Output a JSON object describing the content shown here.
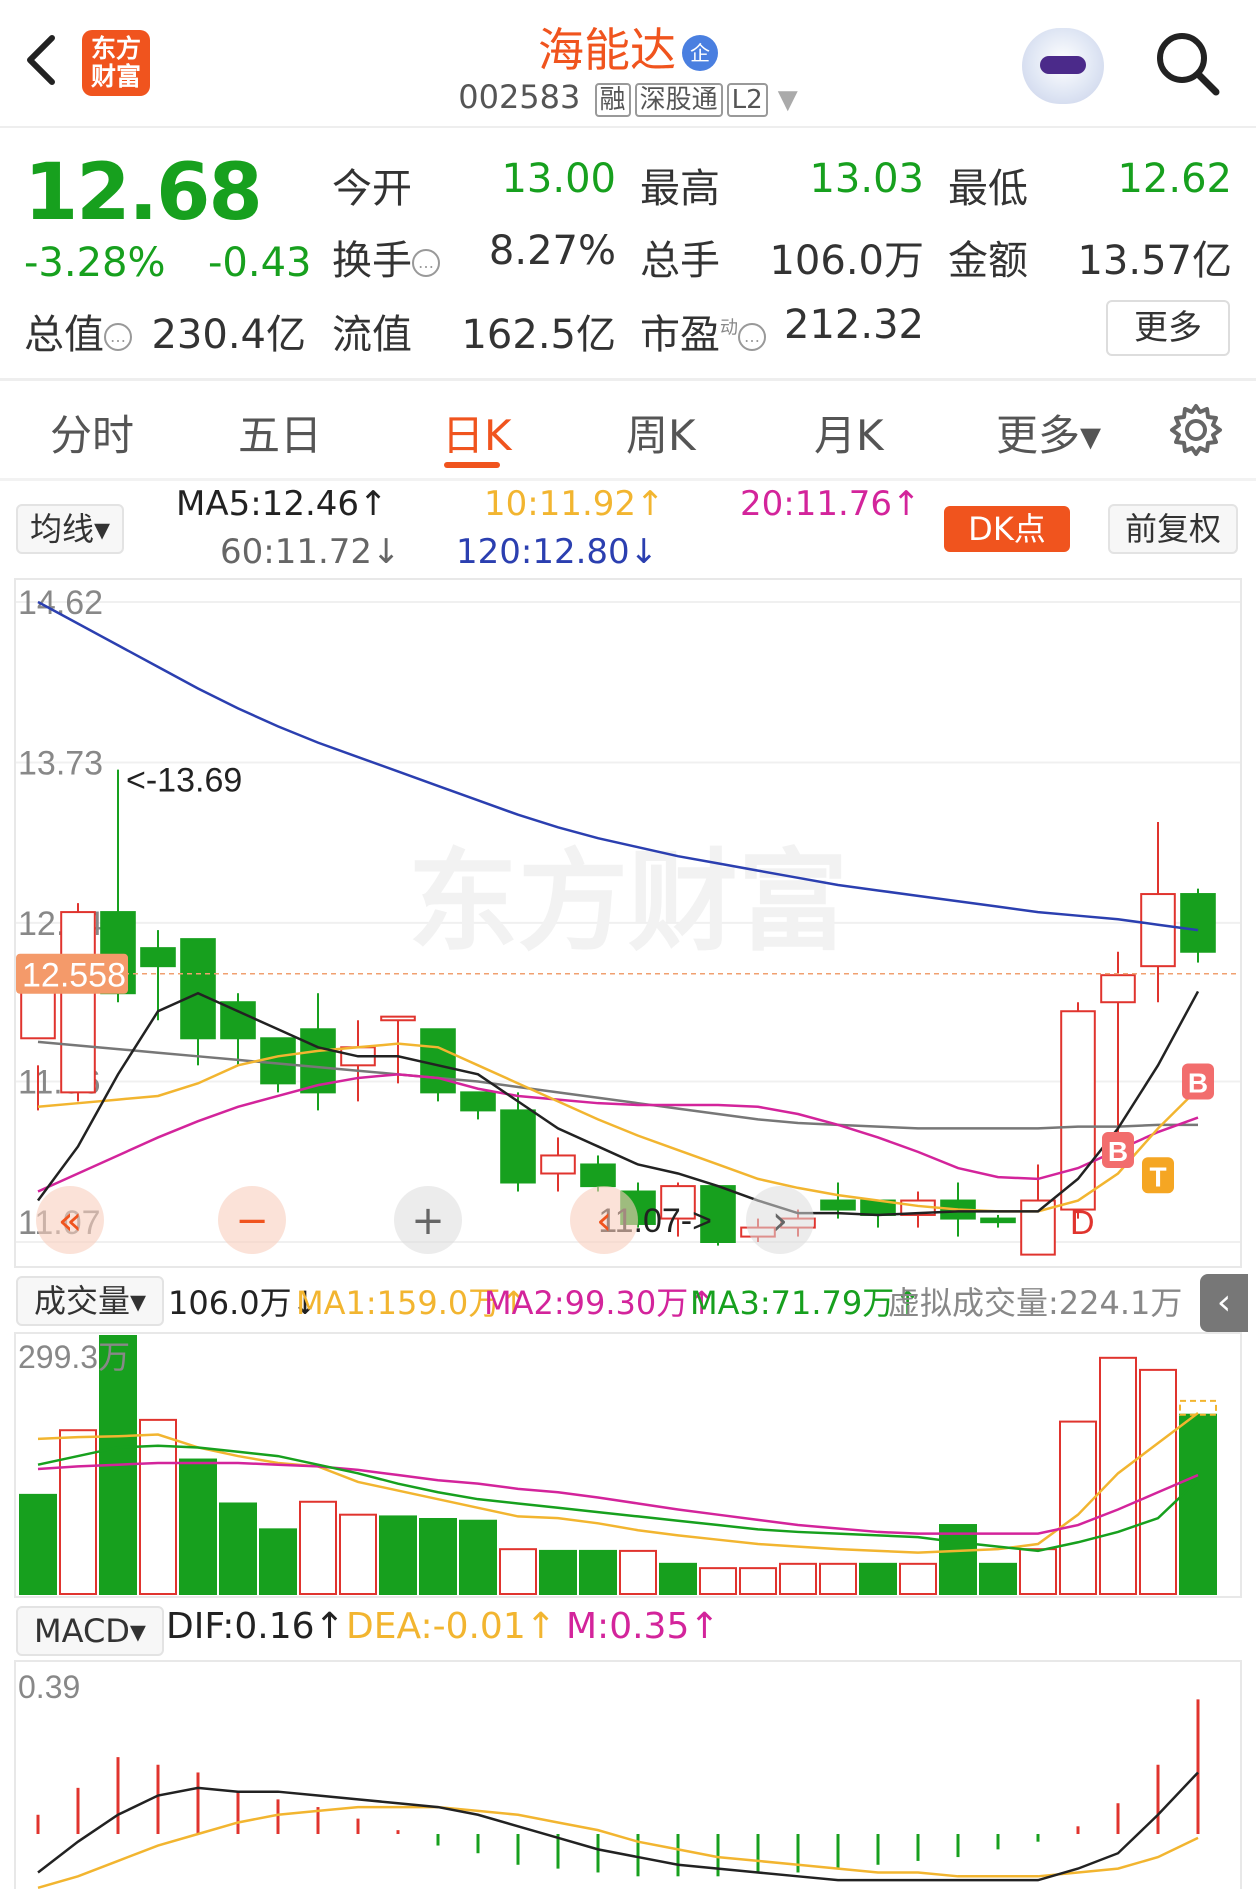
{
  "header": {
    "back_icon": "chevron-left-icon",
    "logo_text": "东方财富",
    "stock_name": "海能达",
    "badge": "企",
    "stock_code": "002583",
    "tags": [
      "融",
      "深股通",
      "L2"
    ],
    "search_icon": "search-icon"
  },
  "quote": {
    "price": "12.68",
    "change_pct": "-3.28%",
    "change_amt": "-0.43",
    "open_label": "今开",
    "open": "13.00",
    "high_label": "最高",
    "high": "13.03",
    "low_label": "最低",
    "low": "12.62",
    "turnover_label": "换手",
    "turnover": "8.27%",
    "volume_label": "总手",
    "volume": "106.0万",
    "amount_label": "金额",
    "amount": "13.57亿",
    "mktcap_label": "总值",
    "mktcap": "230.4亿",
    "float_label": "流值",
    "float": "162.5亿",
    "pe_label": "市盈",
    "pe_sup": "动",
    "pe": "212.32",
    "more": "更多"
  },
  "tabs": [
    {
      "label": "分时"
    },
    {
      "label": "五日"
    },
    {
      "label": "日K"
    },
    {
      "label": "周K"
    },
    {
      "label": "月K"
    },
    {
      "label": "更多▾"
    }
  ],
  "ma_row": {
    "selector": "均线▾",
    "ma5": "MA5:12.46↑",
    "ma10": "10:11.92↑",
    "ma20": "20:11.76↑",
    "ma60": "60:11.72↓",
    "ma120": "120:12.80↓",
    "dk": "DK点",
    "adjust": "前复权"
  },
  "kline": {
    "y_labels": [
      "14.62",
      "13.73",
      "12.84",
      "11.96",
      "11.07"
    ],
    "current_price_label": "12.558",
    "high_marker": "<-13.69",
    "low_marker": "11.07->",
    "watermark": "东方财富",
    "signals": [
      "B",
      "B",
      "T",
      "D"
    ]
  },
  "volume": {
    "selector": "成交量▾",
    "value": "106.0万↓",
    "ma1": "MA1:159.0万↑",
    "ma2": "MA2:99.30万↑",
    "ma3": "MA3:71.79万↑",
    "virtual": "虚拟成交量:224.1万",
    "max_label": "299.3万"
  },
  "macd": {
    "selector": "MACD▾",
    "dif": "DIF:0.16↑",
    "dea": "DEA:-0.01↑",
    "m": "M:0.35↑",
    "max_label": "0.39"
  },
  "colors": {
    "up": "#e0342e",
    "down": "#17a01e",
    "accent": "#f0541e",
    "ma5": "#222222",
    "ma10": "#f2b530",
    "ma20": "#d3249b",
    "ma60": "#777777",
    "ma120": "#2b3fb0"
  },
  "chart_data": [
    {
      "type": "candlestick",
      "title": "",
      "y_ticks": [
        14.62,
        13.73,
        12.84,
        11.96,
        11.07
      ],
      "high_marker": 13.69,
      "low_marker": 11.07,
      "ohlc": [
        [
          12.2,
          12.05,
          11.8,
          12.55
        ],
        [
          11.9,
          12.95,
          11.85,
          12.9
        ],
        [
          12.9,
          13.69,
          12.4,
          12.45
        ],
        [
          12.7,
          12.8,
          12.3,
          12.6
        ],
        [
          12.75,
          12.75,
          12.05,
          12.2
        ],
        [
          12.4,
          12.45,
          12.05,
          12.2
        ],
        [
          12.2,
          12.2,
          11.9,
          11.95
        ],
        [
          12.25,
          12.45,
          11.8,
          11.9
        ],
        [
          12.05,
          12.3,
          11.85,
          12.15
        ],
        [
          12.3,
          12.32,
          11.95,
          12.32
        ],
        [
          12.25,
          12.25,
          11.85,
          11.9
        ],
        [
          11.9,
          11.9,
          11.75,
          11.8
        ],
        [
          11.8,
          11.9,
          11.35,
          11.4
        ],
        [
          11.45,
          11.65,
          11.35,
          11.55
        ],
        [
          11.5,
          11.55,
          11.35,
          11.38
        ],
        [
          11.35,
          11.4,
          11.15,
          11.17
        ],
        [
          11.2,
          11.4,
          11.1,
          11.38
        ],
        [
          11.38,
          11.38,
          11.05,
          11.07
        ],
        [
          11.1,
          11.2,
          11.07,
          11.15
        ],
        [
          11.15,
          11.25,
          11.1,
          11.2
        ],
        [
          11.3,
          11.4,
          11.2,
          11.25
        ],
        [
          11.3,
          11.3,
          11.15,
          11.22
        ],
        [
          11.22,
          11.35,
          11.15,
          11.3
        ],
        [
          11.3,
          11.4,
          11.1,
          11.2
        ],
        [
          11.2,
          11.22,
          11.15,
          11.18
        ],
        [
          11.0,
          11.5,
          11.0,
          11.3
        ],
        [
          11.25,
          12.4,
          11.2,
          12.35
        ],
        [
          12.4,
          12.68,
          11.6,
          12.55
        ],
        [
          12.6,
          13.4,
          12.4,
          13.0
        ],
        [
          13.0,
          13.03,
          12.62,
          12.68
        ]
      ],
      "ma5": [
        11.3,
        11.6,
        12.0,
        12.35,
        12.45,
        12.35,
        12.25,
        12.15,
        12.1,
        12.1,
        12.05,
        12.0,
        11.85,
        11.7,
        11.6,
        11.5,
        11.45,
        11.38,
        11.3,
        11.23,
        11.23,
        11.22,
        11.23,
        11.24,
        11.24,
        11.24,
        11.42,
        11.7,
        12.05,
        12.46
      ],
      "ma10": [
        11.82,
        11.84,
        11.86,
        11.88,
        11.95,
        12.05,
        12.1,
        12.13,
        12.15,
        12.17,
        12.15,
        12.05,
        11.95,
        11.85,
        11.75,
        11.66,
        11.58,
        11.5,
        11.42,
        11.37,
        11.33,
        11.3,
        11.27,
        11.25,
        11.24,
        11.24,
        11.3,
        11.45,
        11.7,
        11.92
      ],
      "ma20": [
        11.35,
        11.45,
        11.55,
        11.65,
        11.74,
        11.82,
        11.88,
        11.94,
        11.98,
        12.0,
        11.98,
        11.92,
        11.88,
        11.86,
        11.84,
        11.83,
        11.83,
        11.83,
        11.82,
        11.78,
        11.72,
        11.65,
        11.57,
        11.48,
        11.43,
        11.42,
        11.48,
        11.58,
        11.68,
        11.76
      ],
      "ma60": [
        12.18,
        12.16,
        12.14,
        12.12,
        12.1,
        12.08,
        12.06,
        12.04,
        12.02,
        12.0,
        11.98,
        11.96,
        11.93,
        11.9,
        11.87,
        11.84,
        11.81,
        11.78,
        11.75,
        11.73,
        11.72,
        11.71,
        11.7,
        11.7,
        11.7,
        11.7,
        11.71,
        11.71,
        11.72,
        11.72
      ],
      "ma120": [
        14.62,
        14.5,
        14.38,
        14.26,
        14.14,
        14.03,
        13.93,
        13.84,
        13.76,
        13.68,
        13.6,
        13.52,
        13.44,
        13.37,
        13.31,
        13.26,
        13.21,
        13.17,
        13.13,
        13.09,
        13.05,
        13.02,
        12.99,
        12.96,
        12.93,
        12.9,
        12.88,
        12.86,
        12.83,
        12.8
      ]
    },
    {
      "type": "bar",
      "title": "成交量",
      "unit": "万",
      "ymax": 299.3,
      "values": [
        115,
        190,
        299.3,
        202,
        156,
        105,
        75,
        107,
        92,
        90,
        87,
        85,
        52,
        50,
        50,
        50,
        35,
        30,
        30,
        35,
        35,
        35,
        35,
        80,
        35,
        52,
        200,
        274,
        260,
        208
      ],
      "up": [
        false,
        true,
        false,
        true,
        false,
        false,
        false,
        true,
        true,
        false,
        false,
        false,
        true,
        false,
        false,
        true,
        false,
        true,
        true,
        true,
        true,
        false,
        true,
        false,
        false,
        true,
        true,
        true,
        true,
        false
      ],
      "ma1": [
        180,
        182,
        183,
        185,
        170,
        160,
        152,
        148,
        130,
        120,
        110,
        100,
        90,
        88,
        82,
        74,
        68,
        63,
        58,
        55,
        52,
        50,
        48,
        50,
        52,
        58,
        92,
        140,
        175,
        210
      ],
      "ma2": [
        145,
        148,
        150,
        152,
        152,
        152,
        150,
        148,
        144,
        138,
        132,
        128,
        122,
        118,
        112,
        105,
        98,
        92,
        86,
        80,
        76,
        72,
        70,
        70,
        70,
        70,
        80,
        98,
        118,
        138
      ],
      "ma3": [
        150,
        160,
        170,
        172,
        170,
        165,
        160,
        150,
        140,
        128,
        118,
        110,
        105,
        100,
        95,
        90,
        85,
        80,
        75,
        72,
        70,
        68,
        66,
        60,
        55,
        50,
        60,
        72,
        88,
        132
      ]
    },
    {
      "type": "bar",
      "title": "MACD",
      "ymax": 0.39,
      "values": [
        0.05,
        0.12,
        0.2,
        0.18,
        0.16,
        0.11,
        0.09,
        0.07,
        0.04,
        0.01,
        -0.03,
        -0.05,
        -0.08,
        -0.09,
        -0.1,
        -0.11,
        -0.11,
        -0.11,
        -0.1,
        -0.1,
        -0.09,
        -0.08,
        -0.07,
        -0.06,
        -0.04,
        -0.02,
        0.02,
        0.08,
        0.18,
        0.35
      ],
      "dif": [
        -0.1,
        -0.02,
        0.05,
        0.1,
        0.12,
        0.11,
        0.11,
        0.1,
        0.09,
        0.08,
        0.07,
        0.05,
        0.02,
        -0.01,
        -0.04,
        -0.06,
        -0.08,
        -0.09,
        -0.1,
        -0.11,
        -0.12,
        -0.12,
        -0.12,
        -0.12,
        -0.12,
        -0.12,
        -0.09,
        -0.05,
        0.05,
        0.16
      ],
      "dea": [
        -0.14,
        -0.11,
        -0.07,
        -0.03,
        0.0,
        0.03,
        0.05,
        0.06,
        0.07,
        0.07,
        0.07,
        0.06,
        0.05,
        0.03,
        0.01,
        -0.02,
        -0.04,
        -0.06,
        -0.07,
        -0.08,
        -0.09,
        -0.1,
        -0.1,
        -0.11,
        -0.11,
        -0.11,
        -0.1,
        -0.09,
        -0.06,
        -0.01
      ]
    }
  ]
}
